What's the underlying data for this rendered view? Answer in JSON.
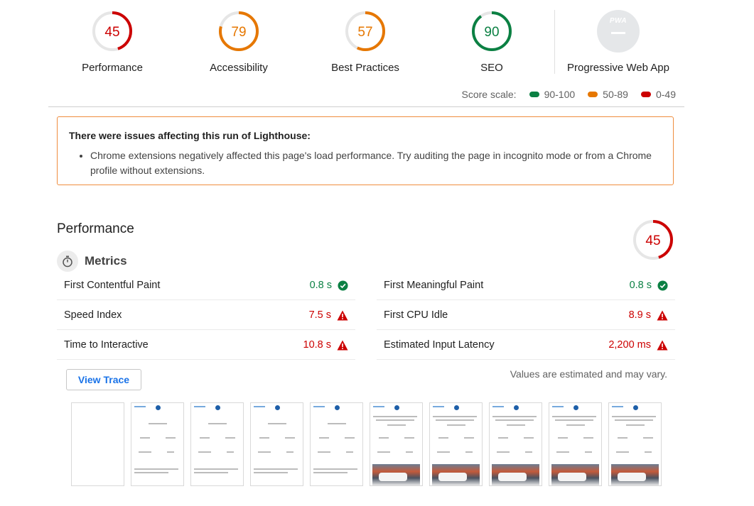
{
  "colors": {
    "pass": "#0b8043",
    "average": "#e67700",
    "fail": "#cc0000",
    "track": "#e6e6e6"
  },
  "gauges": [
    {
      "score": 45,
      "label": "Performance",
      "color": "#cc0000"
    },
    {
      "score": 79,
      "label": "Accessibility",
      "color": "#e67700"
    },
    {
      "score": 57,
      "label": "Best Practices",
      "color": "#e67700"
    },
    {
      "score": 90,
      "label": "SEO",
      "color": "#0b8043"
    }
  ],
  "pwa": {
    "badge_text": "PWA",
    "label": "Progressive Web App",
    "icon": "pwa-badge-icon"
  },
  "score_scale": {
    "label": "Score scale:",
    "ranges": [
      {
        "text": "90-100",
        "color": "#0b8043"
      },
      {
        "text": "50-89",
        "color": "#e67700"
      },
      {
        "text": "0-49",
        "color": "#cc0000"
      }
    ]
  },
  "warning": {
    "title": "There were issues affecting this run of Lighthouse:",
    "items": [
      "Chrome extensions negatively affected this page's load performance. Try auditing the page in incognito mode or from a Chrome profile without extensions."
    ]
  },
  "performance": {
    "title": "Performance",
    "score": 45,
    "score_color": "#cc0000",
    "metrics_title": "Metrics",
    "metrics_icon": "stopwatch-icon",
    "metrics": [
      {
        "name": "First Contentful Paint",
        "value": "0.8 s",
        "status": "pass"
      },
      {
        "name": "First Meaningful Paint",
        "value": "0.8 s",
        "status": "pass"
      },
      {
        "name": "Speed Index",
        "value": "7.5 s",
        "status": "fail"
      },
      {
        "name": "First CPU Idle",
        "value": "8.9 s",
        "status": "fail"
      },
      {
        "name": "Time to Interactive",
        "value": "10.8 s",
        "status": "fail"
      },
      {
        "name": "Estimated Input Latency",
        "value": "2,200 ms",
        "status": "fail"
      }
    ],
    "view_trace_label": "View Trace",
    "estimate_note": "Values are estimated and may vary."
  },
  "filmstrip": {
    "frames": [
      {
        "kind": "blank"
      },
      {
        "kind": "text"
      },
      {
        "kind": "text"
      },
      {
        "kind": "text"
      },
      {
        "kind": "text"
      },
      {
        "kind": "image"
      },
      {
        "kind": "image"
      },
      {
        "kind": "image"
      },
      {
        "kind": "image"
      },
      {
        "kind": "image"
      }
    ]
  }
}
